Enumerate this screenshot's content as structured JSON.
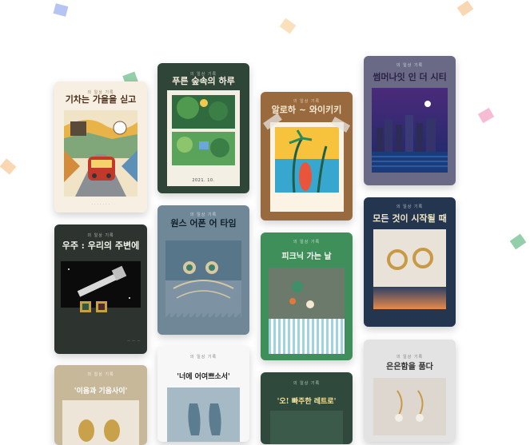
{
  "cards": [
    {
      "title": "기차는 가을을 싣고",
      "top": "의 일상 기록"
    },
    {
      "title": "푸른 숲속의 하루",
      "top": "의 일상 기록",
      "caption": "2021. 10."
    },
    {
      "title": "알로하 ~ 와이키키",
      "top": "의 일상 기록"
    },
    {
      "title": "썸머나잇 인 더 시티",
      "top": "의 일상 기록"
    },
    {
      "title": "우주 : 우리의 주변에",
      "top": "의 일상 기록"
    },
    {
      "title": "원스 어폰 어 타임",
      "top": "의 일상 기록"
    },
    {
      "title": "피크닉 가는 날",
      "top": "의 일상 기록"
    },
    {
      "title": "모든 것이 시작될 때",
      "top": "의 일상 기록"
    },
    {
      "title": "'이음과 기음사이'",
      "top": "의 일상 기록"
    },
    {
      "title": "'너에 어여쁘소서'",
      "top": "의 일상 기록"
    },
    {
      "title": "'오! 빠주한 레트로'",
      "top": "의 일상 기록"
    },
    {
      "title": "은은함을 품다",
      "top": "의 일상 기록"
    }
  ],
  "colors": {
    "confetti": [
      "#9db0f0",
      "#f7c99a",
      "#f8d7a6",
      "#6dbf8d",
      "#f2a6c4"
    ]
  }
}
